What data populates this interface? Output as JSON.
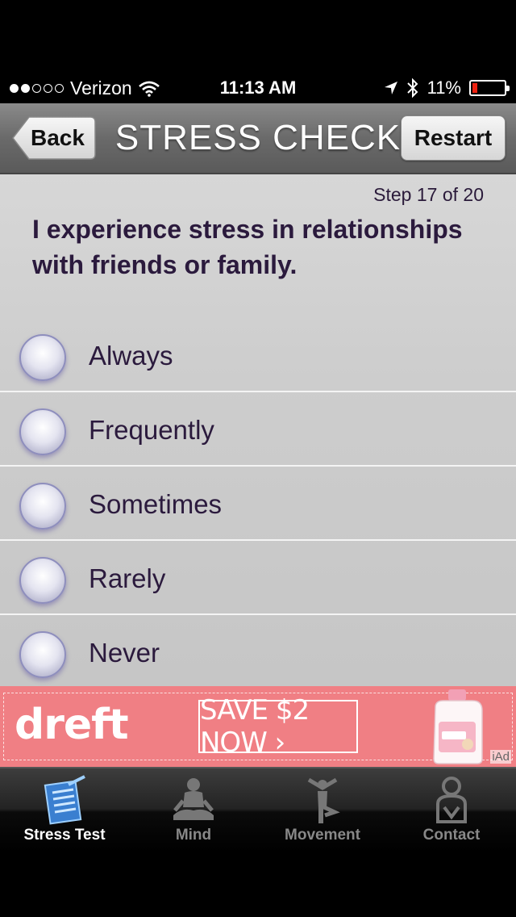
{
  "status_bar": {
    "carrier": "Verizon",
    "time": "11:13 AM",
    "battery_percent": "11%",
    "signal_bars_filled": 2,
    "signal_bars_total": 5
  },
  "nav": {
    "title": "STRESS CHECK",
    "back_label": "Back",
    "restart_label": "Restart"
  },
  "quiz": {
    "step": "Step 17 of 20",
    "question": "I experience stress in relationships with friends or family.",
    "options": [
      {
        "label": "Always"
      },
      {
        "label": "Frequently"
      },
      {
        "label": "Sometimes"
      },
      {
        "label": "Rarely"
      },
      {
        "label": "Never"
      }
    ]
  },
  "ad": {
    "brand": "dreft",
    "cta": "SAVE $2 NOW ›",
    "badge": "iAd",
    "background_color": "#f07f84"
  },
  "tabs": [
    {
      "label": "Stress Test",
      "icon": "checklist-icon",
      "active": true
    },
    {
      "label": "Mind",
      "icon": "meditation-icon",
      "active": false
    },
    {
      "label": "Movement",
      "icon": "yoga-pose-icon",
      "active": false
    },
    {
      "label": "Contact",
      "icon": "contact-person-icon",
      "active": false
    }
  ]
}
